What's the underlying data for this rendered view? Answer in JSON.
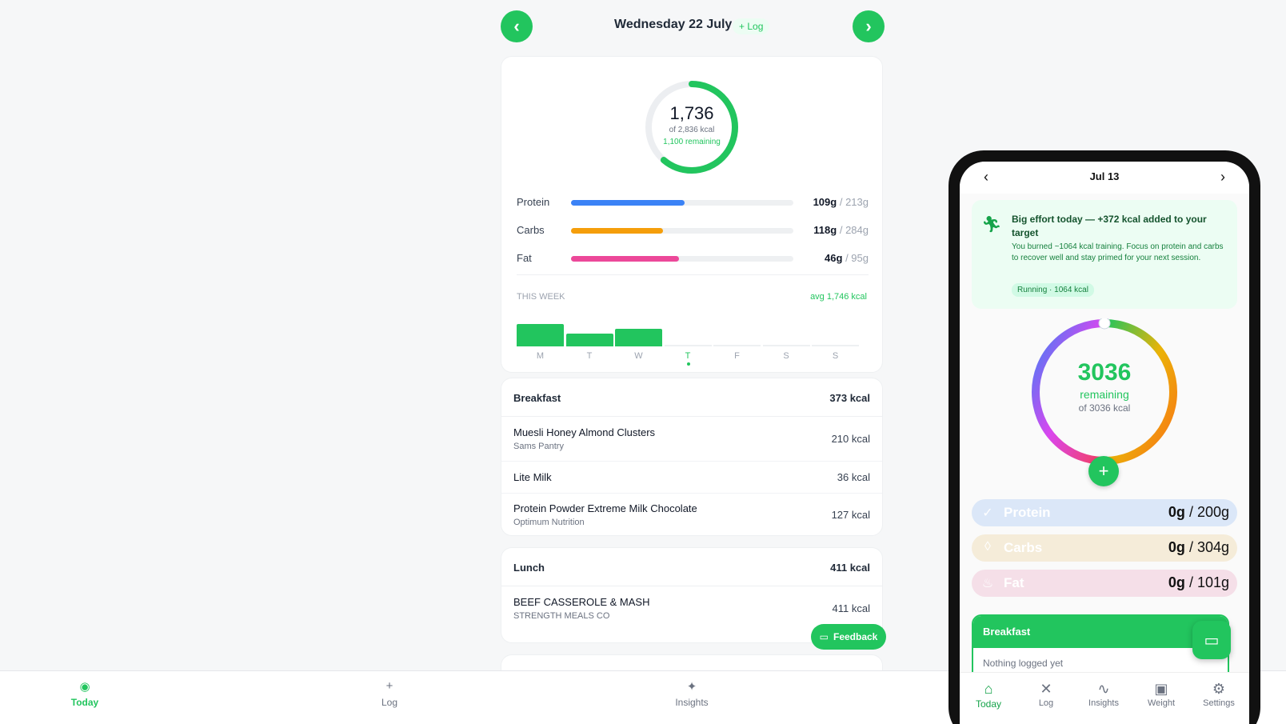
{
  "header": {
    "prev_icon": "chevron-left-icon",
    "date": "Wednesday 22 July",
    "log_chip": "+ Log",
    "next_icon": "chevron-right-icon"
  },
  "summary": {
    "kcal": "1,736",
    "of_target": "of 2,836 kcal",
    "remaining": "1,100 remaining",
    "progress": 0.612,
    "macros": [
      {
        "name": "Protein",
        "value": "109g",
        "target": "/ 213g",
        "fraction": 0.51,
        "color": "#3b82f6"
      },
      {
        "name": "Carbs",
        "value": "118g",
        "target": "/ 284g",
        "fraction": 0.415,
        "color": "#f59e0b"
      },
      {
        "name": "Fat",
        "value": "46g",
        "target": "/ 95g",
        "fraction": 0.485,
        "color": "#ec4899"
      }
    ],
    "week_label": "THIS WEEK",
    "week_avg": "avg 1,746 kcal",
    "week": [
      {
        "day": "M",
        "fraction": 1.0,
        "today": false
      },
      {
        "day": "T",
        "fraction": 0.58,
        "today": false
      },
      {
        "day": "W",
        "fraction": 0.8,
        "today": false
      },
      {
        "day": "T",
        "fraction": 0,
        "today": true
      },
      {
        "day": "F",
        "fraction": 0,
        "today": false
      },
      {
        "day": "S",
        "fraction": 0,
        "today": false
      },
      {
        "day": "S",
        "fraction": 0,
        "today": false
      }
    ]
  },
  "meals": {
    "breakfast": {
      "title": "Breakfast",
      "kcal": "373 kcal",
      "items": [
        {
          "name": "Muesli Honey Almond Clusters",
          "brand": "Sams Pantry",
          "kcal": "210 kcal"
        },
        {
          "name": "Lite Milk",
          "brand": "",
          "kcal": "36 kcal"
        },
        {
          "name": "Protein Powder Extreme Milk Chocolate",
          "brand": "Optimum Nutrition",
          "kcal": "127 kcal"
        }
      ]
    },
    "lunch": {
      "title": "Lunch",
      "kcal": "411 kcal",
      "items": [
        {
          "name": "BEEF CASSEROLE & MASH",
          "brand": "STRENGTH MEALS CO",
          "kcal": "411 kcal"
        }
      ]
    }
  },
  "feedback": {
    "label": "Feedback",
    "icon": "chat-bubble-icon"
  },
  "bottom_nav": [
    {
      "label": "Today",
      "icon": "◉",
      "active": true
    },
    {
      "label": "Log",
      "icon": "+",
      "active": false
    },
    {
      "label": "Insights",
      "icon": "✦",
      "active": false
    }
  ],
  "phone": {
    "date": "Jul 13",
    "banner": {
      "icon": "running-icon",
      "title": "Big effort today — +372 kcal added to your target",
      "body": "You burned ~1064 kcal training. Focus on protein and carbs to recover well and stay primed for your next session.",
      "tag": "Running · 1064 kcal"
    },
    "ring": {
      "value": "3036",
      "remaining_label": "remaining",
      "of_target": "of 3036 kcal"
    },
    "macros": [
      {
        "name": "Protein",
        "value": "0g",
        "target": "/ 200g",
        "bg": "#dbe7f8",
        "icon": "✓"
      },
      {
        "name": "Carbs",
        "value": "0g",
        "target": "/ 304g",
        "bg": "#f5ecd9",
        "icon": "◊"
      },
      {
        "name": "Fat",
        "value": "0g",
        "target": "/ 101g",
        "bg": "#f5dfe8",
        "icon": "♨"
      }
    ],
    "meal": {
      "title": "Breakfast",
      "empty": "Nothing logged yet"
    },
    "nav": [
      {
        "label": "Today",
        "icon": "⌂",
        "active": true
      },
      {
        "label": "Log",
        "icon": "✕",
        "active": false
      },
      {
        "label": "Insights",
        "icon": "∿",
        "active": false
      },
      {
        "label": "Weight",
        "icon": "▣",
        "active": false
      },
      {
        "label": "Settings",
        "icon": "⚙",
        "active": false
      }
    ]
  }
}
